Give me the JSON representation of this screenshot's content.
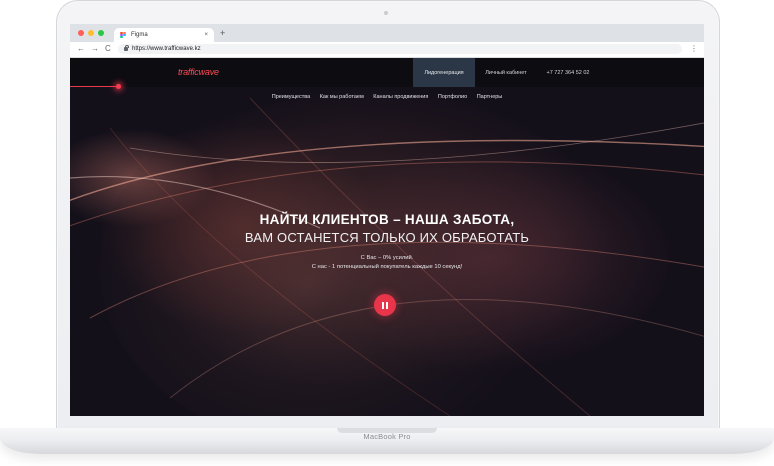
{
  "device": {
    "label": "MacBook Pro"
  },
  "browser": {
    "tab_title": "Figma",
    "tab_close": "×",
    "new_tab": "+",
    "url": "https://www.trafficwave.kz",
    "back": "←",
    "forward": "→",
    "reload": "C",
    "menu": "⋮",
    "dot_colors": [
      "#ff5f57",
      "#ffbd2e",
      "#28c840"
    ]
  },
  "site": {
    "logo": "trafficwave",
    "nav": {
      "lead": "Лидогенерация",
      "cabinet": "Личный кабинет",
      "phone": "+7 727 364 52 02"
    },
    "subnav": [
      "Преимущества",
      "Как мы работаем",
      "Каналы продвижения",
      "Портфолио",
      "Партнеры"
    ],
    "hero": {
      "title": "НАЙТИ КЛИЕНТОВ – НАША ЗАБОТА,",
      "subtitle": "ВАМ ОСТАНЕТСЯ ТОЛЬКО ИХ ОБРАБОТАТЬ",
      "line1": "С Вас – 0% усилий.",
      "line2": "С нас - 1 потенциальный покупатель каждые 10 секунд!"
    },
    "accent_color": "#e8354a",
    "nav_active_color": "#2b3746"
  }
}
